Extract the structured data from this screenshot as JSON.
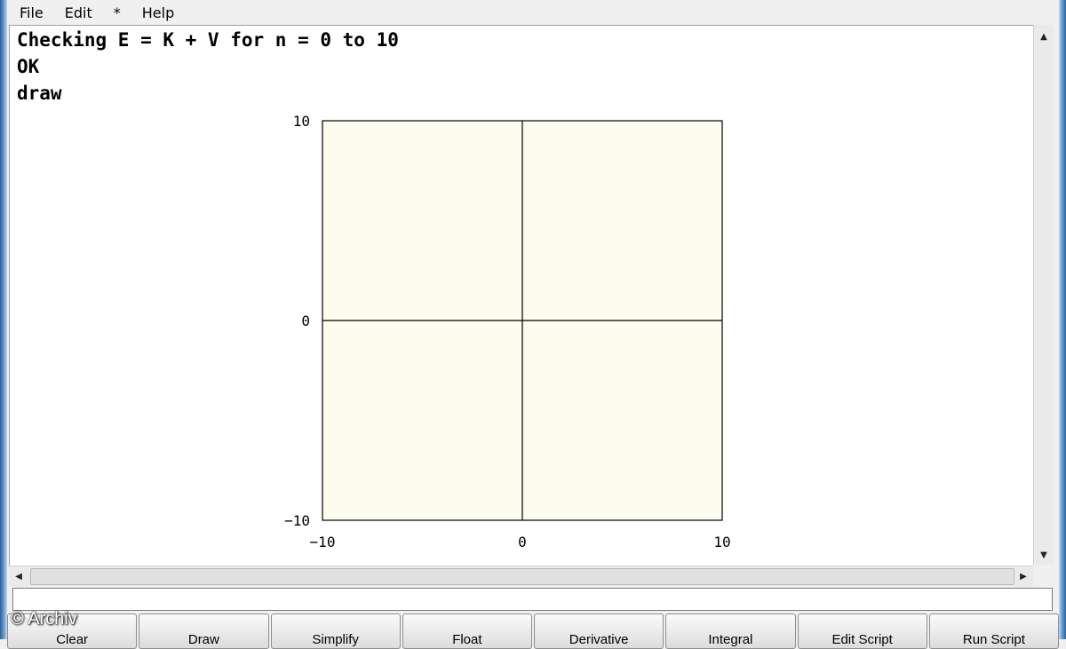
{
  "menu": {
    "items": [
      "File",
      "Edit",
      "*",
      "Help"
    ]
  },
  "console": {
    "lines": [
      "Checking E = K + V for n = 0 to 10",
      "OK",
      "draw"
    ]
  },
  "chart_data": {
    "type": "line",
    "series": [],
    "xlim": [
      -10,
      10
    ],
    "ylim": [
      -10,
      10
    ],
    "x_ticks": [
      "−10",
      "0",
      "10"
    ],
    "y_ticks": [
      "10",
      "0",
      "−10"
    ],
    "background": "#fdfdef",
    "grid": false,
    "axes_crosshair_at_origin": true
  },
  "input": {
    "value": ""
  },
  "buttons": [
    "Clear",
    "Draw",
    "Simplify",
    "Float",
    "Derivative",
    "Integral",
    "Edit Script",
    "Run Script"
  ],
  "watermark": "© Archiv",
  "colors": {
    "frame": "#3a73b6",
    "plot_bg": "#fdfdef"
  }
}
